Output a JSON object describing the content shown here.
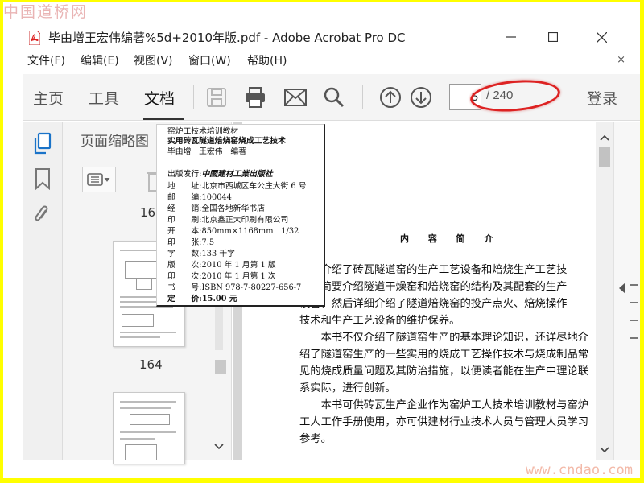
{
  "watermark_top": "中国道桥网",
  "watermark_bottom": "www.cndao.com",
  "window": {
    "title": "毕由增王宏伟编著%5d+2010年版.pdf - Adobe Acrobat Pro DC"
  },
  "menu": {
    "items": [
      "文件(F)",
      "编辑(E)",
      "视图(V)",
      "窗口(W)",
      "帮助(H)"
    ],
    "close": "×"
  },
  "toolbar": {
    "tabs": [
      "主页",
      "工具",
      "文档"
    ],
    "active_tab": "文档",
    "current_page": "5",
    "total_pages": "/ 240",
    "login": "登录"
  },
  "thumbnails": {
    "title": "页面缩略图",
    "labels": [
      "163",
      "164"
    ]
  },
  "copyright_popup": {
    "series": "窑炉工技术培训教材",
    "book_title": "实用砖瓦隧道焙烧窑烧成工艺技术",
    "authors": "毕由增　王宏伟　编著",
    "publisher_label": "出版发行:",
    "publisher_name": "中國建材工業出版社",
    "rows": [
      {
        "k": "地　　址:",
        "v": "北京市西城区车公庄大街 6 号"
      },
      {
        "k": "邮　　编:",
        "v": "100044"
      },
      {
        "k": "经　　销:",
        "v": "全国各地新华书店"
      },
      {
        "k": "印　　刷:",
        "v": "北京鑫正大印刷有限公司"
      },
      {
        "k": "开　　本:",
        "v": "850mm×1168mm　1/32"
      },
      {
        "k": "印　　张:",
        "v": "7.5"
      },
      {
        "k": "字　　数:",
        "v": "133 千字"
      },
      {
        "k": "版　　次:",
        "v": "2010 年 1 月第 1 版"
      },
      {
        "k": "印　　次:",
        "v": "2010 年 1 月第 1 次"
      },
      {
        "k": "书　　号:",
        "v": "ISBN 978-7-80227-656-7"
      },
      {
        "k": "定　　价:",
        "v": "15.00 元"
      }
    ]
  },
  "page_content": {
    "heading": "内 容 简 介",
    "lines": [
      "本书介绍了砖瓦隧道窑的生产工艺设备和焙烧生产工艺技",
      "首先简要介绍隧道干燥窑和焙烧窑的结构及其配套的生产",
      "设备，然后详细介绍了隧道焙烧窑的投产点火、焙烧操作",
      "技术和生产工艺设备的维护保养。",
      "　　本书不仅介绍了隧道窑生产的基本理论知识，还详尽地介",
      "绍了隧道窑生产的一些实用的烧成工艺操作技术与烧成制品常",
      "见的烧成质量问题及其防治措施，以便读者能在生产中理论联",
      "系实际，进行创新。",
      "　　本书可供砖瓦生产企业作为窑炉工人技术培训教材与窑炉",
      "工人工作手册使用，亦可供建材行业技术人员与管理人员学习",
      "参考。"
    ]
  }
}
